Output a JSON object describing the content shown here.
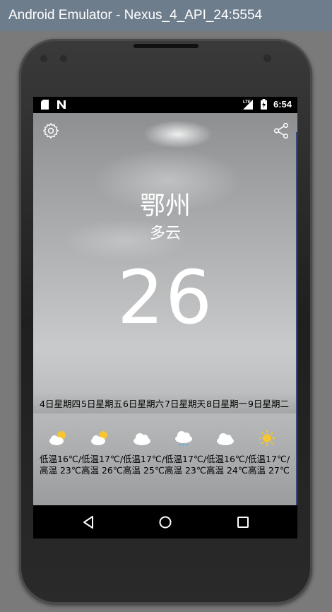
{
  "window": {
    "title": "Android Emulator - Nexus_4_API_24:5554"
  },
  "status_bar": {
    "time": "6:54",
    "network": "LTE"
  },
  "weather": {
    "city": "鄂州",
    "condition": "多云",
    "temperature": "26"
  },
  "forecast": [
    {
      "date": "4日星期四",
      "icon": "partly-cloudy-sun-icon",
      "range": "低温16℃/高温 23℃"
    },
    {
      "date": "5日星期五",
      "icon": "partly-cloudy-sun-icon",
      "range": "低温17℃/高温 26℃"
    },
    {
      "date": "6日星期六",
      "icon": "cloudy-icon",
      "range": "低温17℃/高温 25℃"
    },
    {
      "date": "7日星期天",
      "icon": "light-rain-icon",
      "range": "低温17℃/高温 23℃"
    },
    {
      "date": "8日星期一",
      "icon": "cloudy-icon",
      "range": "低温16℃/高温 24℃"
    },
    {
      "date": "9日星期二",
      "icon": "sunny-icon",
      "range": "低温17℃/高温 27℃"
    }
  ],
  "colors": {
    "accent_edge": "#3b4a7a",
    "titlebar": "#6e7d8c",
    "sun": "#f7c531"
  }
}
